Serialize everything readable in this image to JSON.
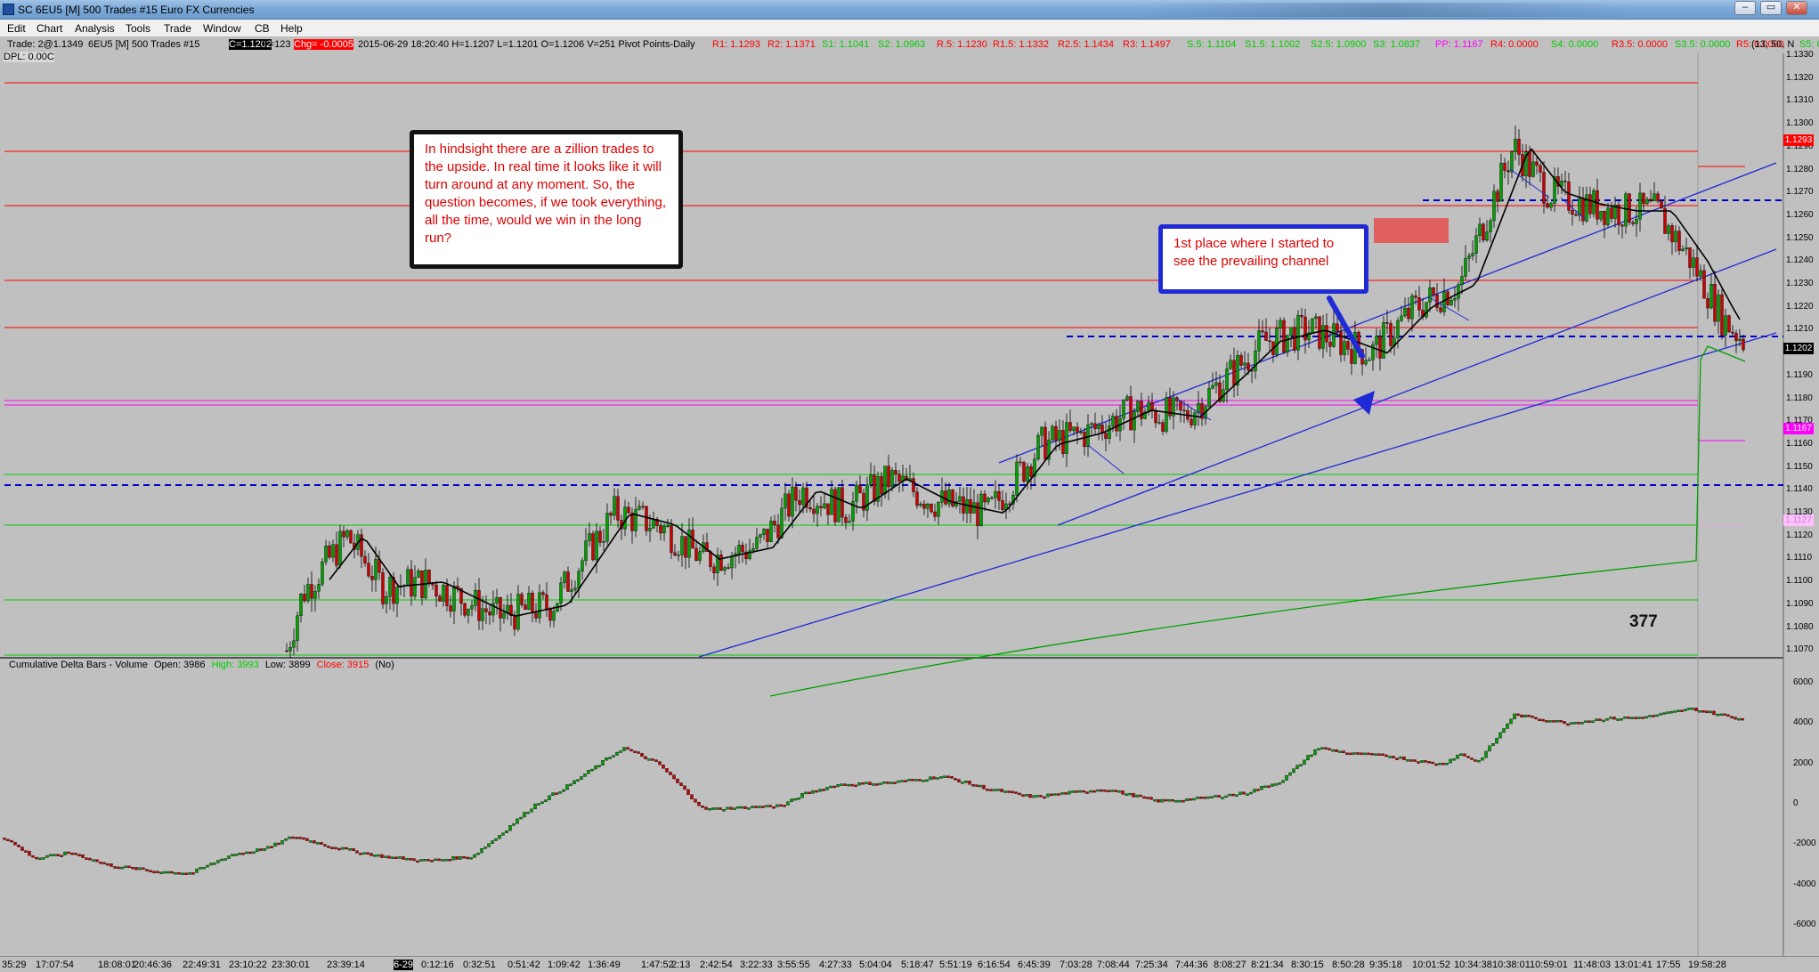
{
  "window": {
    "title": "SC 6EU5 [M]  500 Trades  #15  Euro FX Currencies",
    "controls": [
      "–",
      "▭",
      "✕"
    ]
  },
  "menu": [
    "Edit",
    "Chart",
    "Analysis",
    "Tools",
    "Trade",
    "Window",
    "CB",
    "Help"
  ],
  "info_bar": [
    {
      "text": "Trade: 2@1.1349",
      "color": "#000000",
      "bg": ""
    },
    {
      "text": "6EU5 [M]  500 Trades  #15",
      "color": "#000000",
      "bg": ""
    },
    {
      "text": "C=1.1202",
      "color": "#ffffff",
      "bg": "#000000"
    },
    {
      "text": "T=123",
      "color": "#000000",
      "bg": ""
    },
    {
      "text": "Chg= -0.0005",
      "color": "#ffffff",
      "bg": "#ff0000"
    },
    {
      "text": "2015-06-29  18:20:40  H=1.1207  L=1.1201  O=1.1206  V=251  Pivot Points-Daily",
      "color": "#000000",
      "bg": ""
    },
    {
      "text": "R1: 1.1293",
      "color": "#ff0000",
      "bg": ""
    },
    {
      "text": "R2: 1.1371",
      "color": "#ff0000",
      "bg": ""
    },
    {
      "text": "S1: 1.1041",
      "color": "#00cc00",
      "bg": ""
    },
    {
      "text": "S2: 1.0963",
      "color": "#00cc00",
      "bg": ""
    },
    {
      "text": "R.5: 1.1230",
      "color": "#ff0000",
      "bg": ""
    },
    {
      "text": "R1.5: 1.1332",
      "color": "#ff0000",
      "bg": ""
    },
    {
      "text": "R2.5: 1.1434",
      "color": "#ff0000",
      "bg": ""
    },
    {
      "text": "R3: 1.1497",
      "color": "#ff0000",
      "bg": ""
    },
    {
      "text": "S.5: 1.1104",
      "color": "#00cc00",
      "bg": ""
    },
    {
      "text": "S1.5: 1.1002",
      "color": "#00cc00",
      "bg": ""
    },
    {
      "text": "S2.5: 1.0900",
      "color": "#00cc00",
      "bg": ""
    },
    {
      "text": "S3: 1.0837",
      "color": "#00cc00",
      "bg": ""
    },
    {
      "text": "PP: 1.1167",
      "color": "#ff00ff",
      "bg": ""
    },
    {
      "text": "R4: 0.0000",
      "color": "#ff0000",
      "bg": ""
    },
    {
      "text": "S4: 0.0000",
      "color": "#00cc00",
      "bg": ""
    },
    {
      "text": "R3.5: 0.0000",
      "color": "#ff0000",
      "bg": ""
    },
    {
      "text": "S3.5: 0.0000",
      "color": "#00cc00",
      "bg": ""
    },
    {
      "text": "R5: 0.0000",
      "color": "#ff0000",
      "bg": ""
    },
    {
      "text": "S5: 0.0000",
      "color": "#00cc00",
      "bg": ""
    }
  ],
  "info_corner": "(13, 50, N",
  "dpl": "DPL: 0.00C",
  "price_axis": {
    "ticks": [
      "1.1330",
      "1.1320",
      "1.1310",
      "1.1300",
      "1.1290",
      "1.1280",
      "1.1270",
      "1.1260",
      "1.1250",
      "1.1240",
      "1.1230",
      "1.1220",
      "1.1210",
      "1.1200",
      "1.1190",
      "1.1180",
      "1.1170",
      "1.1160",
      "1.1150",
      "1.1140",
      "1.1130",
      "1.1120",
      "1.1110",
      "1.1100",
      "1.1090",
      "1.1080",
      "1.1070"
    ],
    "tags": [
      {
        "text": "1.1293",
        "value": 1.1293,
        "bg": "#ff0000",
        "color": "#ffffff"
      },
      {
        "text": "1.1202",
        "value": 1.1202,
        "bg": "#000000",
        "color": "#ffffff"
      },
      {
        "text": "1.1167",
        "value": 1.1167,
        "bg": "#ff00ff",
        "color": "#ffffff"
      },
      {
        "text": "1.1127",
        "value": 1.1127,
        "bg": "#ffc0ff",
        "color": "#cc88cc"
      }
    ]
  },
  "delta_axis": {
    "ticks": [
      "6000",
      "4000",
      "2000",
      "0",
      "-2000",
      "-4000",
      "-6000"
    ]
  },
  "time_axis": [
    "35:29",
    "17:07:54",
    "18:08:01",
    "20:46:36",
    "22:49:31",
    "23:10:22",
    "23:30:01",
    "23:39:14",
    "6-29",
    "0:12:16",
    "0:32:51",
    "0:51:42",
    "1:09:42",
    "1:36:49",
    "1:47:52",
    "2:13",
    "2:42:54",
    "3:22:33",
    "3:55:55",
    "4:27:33",
    "5:04:04",
    "5:18:47",
    "5:51:19",
    "6:16:54",
    "6:45:39",
    "7:03:28",
    "7:08:44",
    "7:25:34",
    "7:44:36",
    "8:08:27",
    "8:21:34",
    "8:30:15",
    "8:50:28",
    "9:35:18",
    "10:01:52",
    "10:34:38",
    "10:38:01",
    "10:59:01",
    "11:48:03",
    "13:01:41",
    "17:55",
    "19:58:28"
  ],
  "notes": {
    "hindsight": "In hindsight there are a zillion trades to the upside.  In real time it looks like it will turn around at any moment.  So, the question becomes, if we took everything, all the time, would we win in the long run?",
    "first_place": "1st place where I started to see the prevailing channel"
  },
  "figure_label": "377",
  "lower_panel": {
    "title": "Cumulative Delta Bars - Volume",
    "open": "Open: 3986",
    "high": "High: 3993",
    "low": "Low: 3899",
    "close": "Close: 3915",
    "flag": "(No)"
  },
  "colors": {
    "resistance": "#ff0000",
    "support": "#00cc00",
    "pivot": "#ff00ff",
    "channel": "#1f2ad6",
    "up_bar": "#00a000",
    "down_bar": "#cc0000"
  }
}
